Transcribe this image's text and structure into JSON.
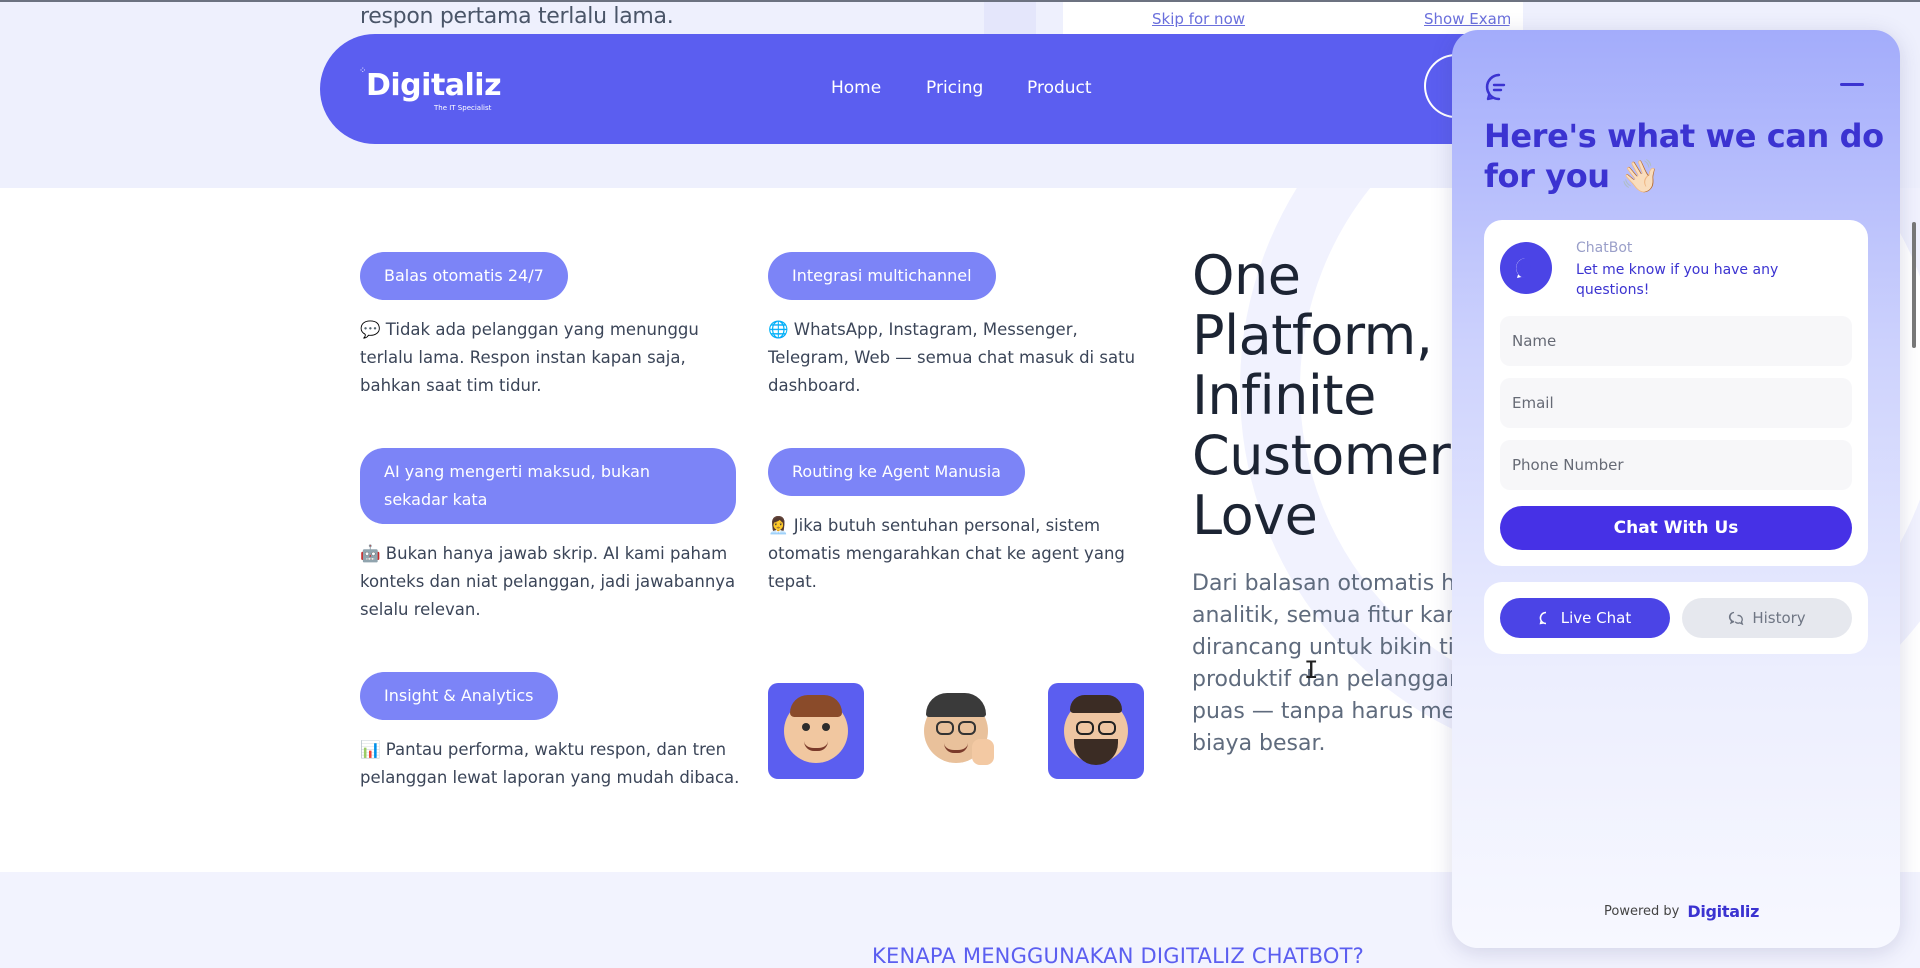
{
  "top_strip": {
    "text": "respon pertama terlalu lama.",
    "skip_link": "Skip for now",
    "example_link": "Show Examj"
  },
  "navbar": {
    "logo": "Digitaliz",
    "logo_tagline": "The IT Specialist",
    "links": [
      "Home",
      "Pricing",
      "Product"
    ]
  },
  "features": [
    {
      "pill": "Balas otomatis 24/7",
      "text": "💬 Tidak ada pelanggan yang menunggu terlalu lama. Respon instan kapan saja, bahkan saat tim tidur."
    },
    {
      "pill": "Integrasi multichannel",
      "text": "🌐 WhatsApp, Instagram, Messenger, Telegram, Web — semua chat masuk di satu dashboard."
    },
    {
      "pill": "AI yang mengerti maksud, bukan sekadar kata",
      "text": "🤖 Bukan hanya jawab skrip. AI kami paham konteks dan niat pelanggan, jadi jawabannya selalu relevan."
    },
    {
      "pill": "Routing ke Agent Manusia",
      "text": "👩‍💼 Jika butuh sentuhan personal, sistem otomatis mengarahkan chat ke agent yang tepat."
    },
    {
      "pill": "Insight & Analytics",
      "text": "📊 Pantau performa, waktu respon, dan tren pelanggan lewat laporan yang mudah dibaca."
    }
  ],
  "hero": {
    "headline": "One Platform, Infinite Customer Love",
    "subheadline": "Dari balasan otomatis hir analitik, semua fitur kam dirancang untuk bikin tim produktif dan pelanggan puas — tanpa harus mer biaya besar."
  },
  "why_title": "KENAPA MENGGUNAKAN DIGITALIZ CHATBOT?",
  "widget": {
    "title": "Here's what we can do for you 👋🏻",
    "bot_name": "ChatBot",
    "bot_message": "Let me know if you have any questions!",
    "name_placeholder": "Name",
    "email_placeholder": "Email",
    "phone_placeholder": "Phone Number",
    "chat_button": "Chat With Us",
    "tab_live": "Live Chat",
    "tab_history": "History",
    "powered_by": "Powered by",
    "powered_logo": "Digitaliz"
  },
  "colors": {
    "brand": "#5b5ef0",
    "pill": "#7c84f7",
    "widget_accent": "#3b33d1",
    "button": "#4631e6"
  },
  "icons": [
    "chat-bubble-icon",
    "minimize-icon",
    "message-icon",
    "history-icon"
  ]
}
